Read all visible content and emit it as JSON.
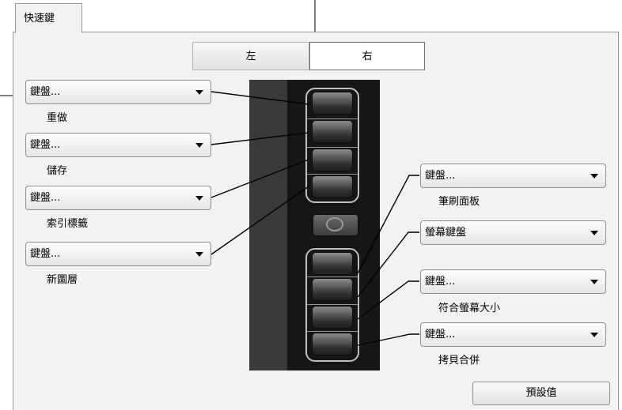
{
  "tab": {
    "label": "快速鍵"
  },
  "side_toggle": {
    "left_label": "左",
    "right_label": "右",
    "selected": "右"
  },
  "left_keys": [
    {
      "dropdown": "鍵盤...",
      "label": "重做"
    },
    {
      "dropdown": "鍵盤...",
      "label": "儲存"
    },
    {
      "dropdown": "鍵盤...",
      "label": "索引標籤"
    },
    {
      "dropdown": "鍵盤...",
      "label": "新圖層"
    }
  ],
  "right_keys": [
    {
      "dropdown": "鍵盤...",
      "label": "筆刷面板"
    },
    {
      "dropdown": "螢幕鍵盤",
      "label": ""
    },
    {
      "dropdown": "鍵盤...",
      "label": "符合螢幕大小"
    },
    {
      "dropdown": "鍵盤...",
      "label": "拷貝合併"
    }
  ],
  "reset_button": {
    "label": "預設值"
  }
}
